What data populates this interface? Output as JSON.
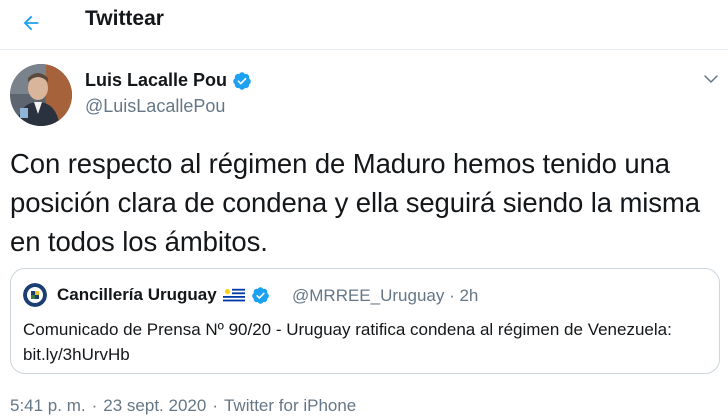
{
  "header": {
    "title": "Twittear"
  },
  "author": {
    "name": "Luis Lacalle Pou",
    "handle": "@LuisLacallePou"
  },
  "tweet": {
    "text": "Con respecto al régimen de Maduro hemos tenido una posición clara de condena y ella seguirá siendo la misma en todos los ámbitos."
  },
  "quote": {
    "name": "Cancillería Uruguay",
    "handle": "@MRREE_Uruguay · 2h",
    "text": "Comunicado de Prensa Nº 90/20 - Uruguay ratifica condena al régimen de Venezuela: bit.ly/3hUrvHb"
  },
  "meta": {
    "time": "5:41 p. m.",
    "sep1": "·",
    "date": "23 sept. 2020",
    "sep2": "·",
    "source": "Twitter for iPhone"
  },
  "colors": {
    "accent": "#1da1f2",
    "verified": "#1da1f2",
    "text": "#14171a",
    "secondary": "#657786",
    "border": "#ccd6dd"
  },
  "icons": {
    "back": "arrow-left-icon",
    "verified": "verified-badge-icon",
    "caret": "chevron-down-icon",
    "flag": "uruguay-flag-icon"
  }
}
